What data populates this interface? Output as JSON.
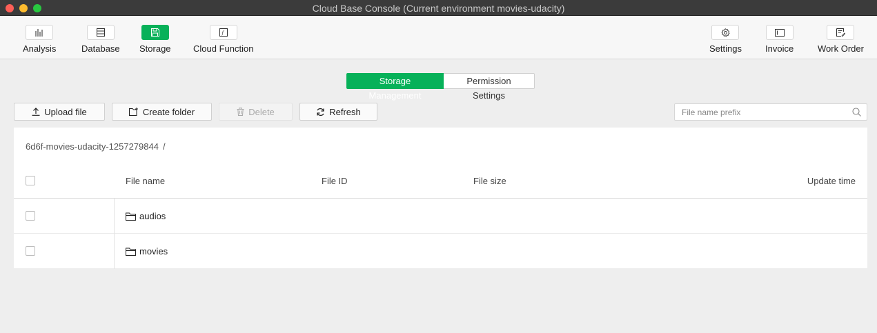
{
  "window": {
    "title": "Cloud Base Console (Current environment movies-udacity)"
  },
  "toolbar": {
    "left": [
      {
        "label": "Analysis",
        "icon": "bar-chart-icon"
      },
      {
        "label": "Database",
        "icon": "database-icon"
      },
      {
        "label": "Storage",
        "icon": "storage-icon",
        "active": true
      },
      {
        "label": "Cloud Function",
        "icon": "function-icon"
      }
    ],
    "right": [
      {
        "label": "Settings",
        "icon": "gear-icon"
      },
      {
        "label": "Invoice",
        "icon": "invoice-icon"
      },
      {
        "label": "Work Order",
        "icon": "work-order-icon"
      }
    ]
  },
  "tabs": {
    "active": "Storage Management",
    "inactive": "Permission Settings"
  },
  "actions": {
    "upload": "Upload file",
    "create_folder": "Create folder",
    "delete": "Delete",
    "refresh": "Refresh"
  },
  "search": {
    "placeholder": "File name prefix"
  },
  "breadcrumb": {
    "bucket": "6d6f-movies-udacity-1257279844",
    "separator": "/"
  },
  "table": {
    "columns": {
      "name": "File name",
      "id": "File ID",
      "size": "File size",
      "time": "Update time"
    },
    "rows": [
      {
        "name": "audios",
        "type": "folder"
      },
      {
        "name": "movies",
        "type": "folder"
      }
    ]
  },
  "colors": {
    "accent": "#07b159"
  }
}
